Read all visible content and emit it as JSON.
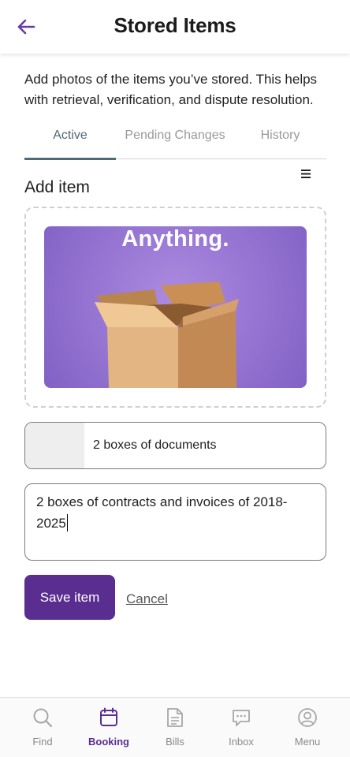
{
  "header": {
    "title": "Stored Items",
    "back_icon": "arrow-left-icon"
  },
  "intro": {
    "text": "Add photos of the items you’ve stored. This helps with retrieval, verification, and dispute resolution."
  },
  "tabs": [
    {
      "label": "Active",
      "active": true
    },
    {
      "label": "Pending Changes",
      "active": false
    },
    {
      "label": "History",
      "active": false
    }
  ],
  "form": {
    "menu_icon": "hamburger-menu-icon",
    "heading": "Add item",
    "photo_caption": "Anything.",
    "name_value": "2 boxes of documents",
    "description_value": "2 boxes of contracts and invoices of 2018-2025",
    "save_label": "Save item",
    "cancel_label": "Cancel"
  },
  "bottom_nav": [
    {
      "label": "Find",
      "icon": "search-icon",
      "active": false
    },
    {
      "label": "Booking",
      "icon": "calendar-icon",
      "active": true
    },
    {
      "label": "Bills",
      "icon": "document-icon",
      "active": false
    },
    {
      "label": "Inbox",
      "icon": "chat-icon",
      "active": false
    },
    {
      "label": "Menu",
      "icon": "user-circle-icon",
      "active": false
    }
  ],
  "colors": {
    "accent": "#5a2d91",
    "active_tab": "#4d6a78",
    "photo_background": "#9b7ad6"
  }
}
